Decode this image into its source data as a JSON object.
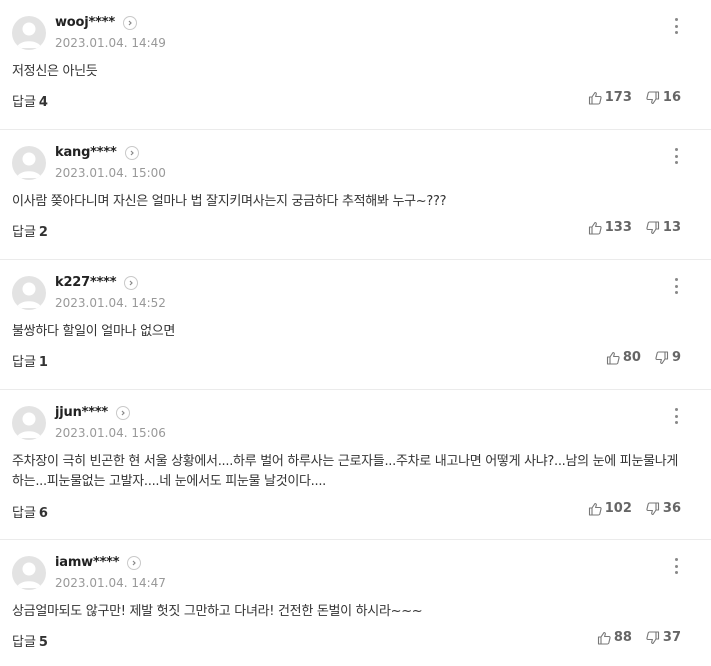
{
  "comments": [
    {
      "nick": "wooj****",
      "date": "2023.01.04. 14:49",
      "text": "저정신은 아닌듯",
      "reply_label": "답글",
      "reply_count": "4",
      "likes": "173",
      "dislikes": "16"
    },
    {
      "nick": "kang****",
      "date": "2023.01.04. 15:00",
      "text": "이사람 쫒아다니며 자신은 얼마나 법 잘지키며사는지 궁금하다 추적해봐 누구~???",
      "reply_label": "답글",
      "reply_count": "2",
      "likes": "133",
      "dislikes": "13"
    },
    {
      "nick": "k227****",
      "date": "2023.01.04. 14:52",
      "text": "불쌍하다 할일이 얼마나 없으면",
      "reply_label": "답글",
      "reply_count": "1",
      "likes": "80",
      "dislikes": "9"
    },
    {
      "nick": "jjun****",
      "date": "2023.01.04. 15:06",
      "text": "주차장이 극히 빈곤한 현 서울 상황에서....하루 벌어 하루사는 근로자들...주차로 내고나면 어떻게 사냐?...남의 눈에 피눈물나게하는...피눈물없는 고발자....네 눈에서도 피눈물 날것이다....",
      "reply_label": "답글",
      "reply_count": "6",
      "likes": "102",
      "dislikes": "36"
    },
    {
      "nick": "iamw****",
      "date": "2023.01.04. 14:47",
      "text": "상금얼마되도 않구만! 제발 헛짓 그만하고 다녀라! 건전한 돈벌이 하시라~~~",
      "reply_label": "답글",
      "reply_count": "5",
      "likes": "88",
      "dislikes": "37"
    }
  ]
}
